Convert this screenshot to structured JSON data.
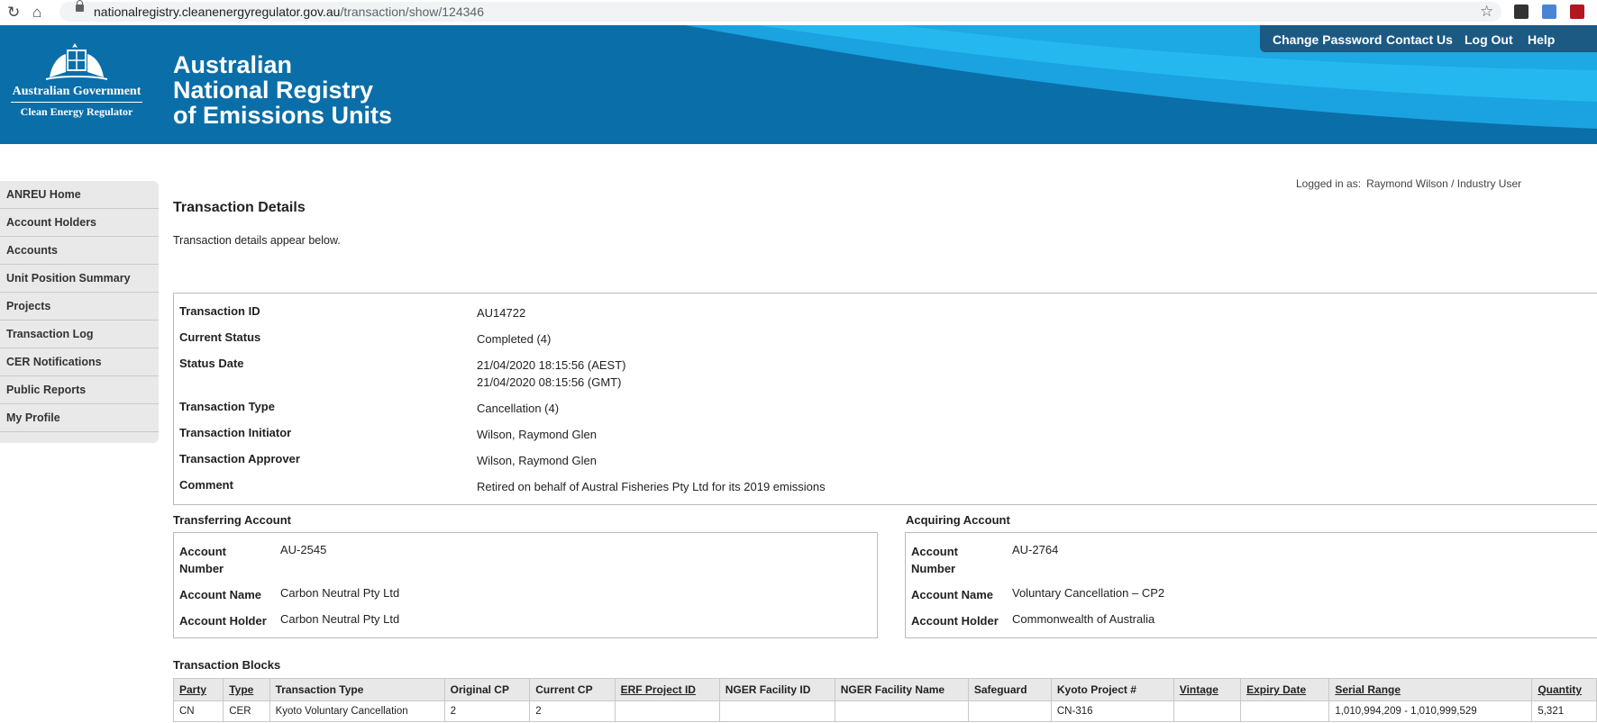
{
  "browser": {
    "url_host": "nationalregistry.cleanenergyregulator.gov.au",
    "url_path": "/transaction/show/124346"
  },
  "header": {
    "gov_name": "Australian Government",
    "agency": "Clean Energy Regulator",
    "title_line1": "Australian",
    "title_line2": "National Registry",
    "title_line3": "of Emissions Units",
    "nav": {
      "change_password": "Change Password",
      "contact_us": "Contact Us",
      "log_out": "Log Out",
      "help": "Help"
    }
  },
  "sidebar": {
    "items": [
      {
        "label": "ANREU Home"
      },
      {
        "label": "Account Holders"
      },
      {
        "label": "Accounts"
      },
      {
        "label": "Unit Position Summary"
      },
      {
        "label": "Projects"
      },
      {
        "label": "Transaction Log"
      },
      {
        "label": "CER Notifications"
      },
      {
        "label": "Public Reports"
      },
      {
        "label": "My Profile"
      }
    ]
  },
  "session": {
    "logged_in_label": "Logged in as:",
    "user": "Raymond Wilson / Industry User"
  },
  "page": {
    "title": "Transaction Details",
    "intro": "Transaction details appear below."
  },
  "details": {
    "transaction_id_label": "Transaction ID",
    "transaction_id": "AU14722",
    "status_label": "Current Status",
    "status": "Completed (4)",
    "status_date_label": "Status Date",
    "status_date_aest": "21/04/2020 18:15:56 (AEST)",
    "status_date_gmt": "21/04/2020 08:15:56 (GMT)",
    "type_label": "Transaction Type",
    "type": "Cancellation (4)",
    "initiator_label": "Transaction Initiator",
    "initiator": "Wilson, Raymond Glen",
    "approver_label": "Transaction Approver",
    "approver": "Wilson, Raymond Glen",
    "comment_label": "Comment",
    "comment": "Retired on behalf of Austral Fisheries Pty Ltd for its 2019 emissions"
  },
  "transferring": {
    "title": "Transferring Account",
    "number_label_1": "Account",
    "number_label_2": "Number",
    "number": "AU-2545",
    "name_label": "Account Name",
    "name": "Carbon Neutral Pty Ltd",
    "holder_label": "Account Holder",
    "holder": "Carbon Neutral Pty Ltd"
  },
  "acquiring": {
    "title": "Acquiring Account",
    "number_label_1": "Account",
    "number_label_2": "Number",
    "number": "AU-2764",
    "name_label": "Account Name",
    "name": "Voluntary Cancellation – CP2",
    "holder_label": "Account Holder",
    "holder": "Commonwealth of Australia"
  },
  "blocks": {
    "title": "Transaction Blocks",
    "headers": [
      "Party",
      "Type",
      "Transaction Type",
      "Original CP",
      "Current CP",
      "ERF Project ID",
      "NGER Facility ID",
      "NGER Facility Name",
      "Safeguard",
      "Kyoto Project #",
      "Vintage",
      "Expiry Date",
      "Serial Range",
      "Quantity"
    ],
    "rows": [
      [
        "CN",
        "CER",
        "Kyoto Voluntary Cancellation",
        "2",
        "2",
        "",
        "",
        "",
        "",
        "CN-316",
        "",
        "",
        "1,010,994,209 - 1,010,999,529",
        "5,321"
      ]
    ]
  }
}
